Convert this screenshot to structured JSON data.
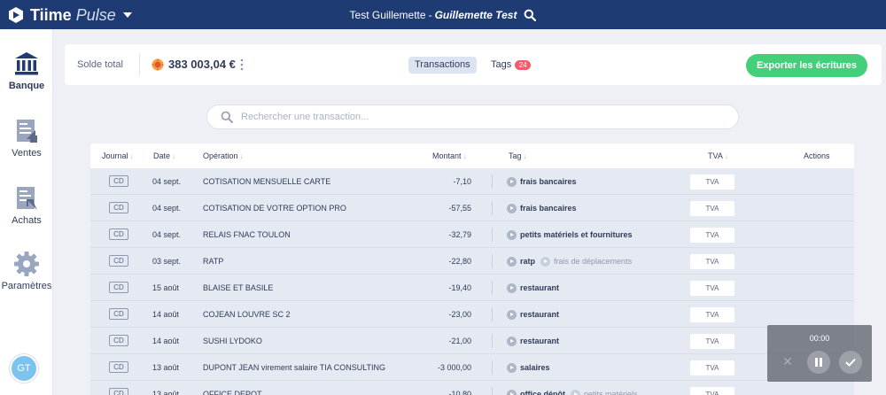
{
  "header": {
    "brand_name": "Tiime",
    "brand_sub": "Pulse",
    "company": "Test Guillemette",
    "separator": "-",
    "user": "Guillemette Test"
  },
  "sidebar": {
    "items": [
      {
        "label": "Banque",
        "icon": "bank-icon",
        "active": true
      },
      {
        "label": "Ventes",
        "icon": "sales-document-icon"
      },
      {
        "label": "Achats",
        "icon": "purchases-document-icon"
      },
      {
        "label": "Paramètres",
        "icon": "gear-icon"
      }
    ],
    "avatar_initials": "GT"
  },
  "summary": {
    "solde_label": "Solde total",
    "balance": "383 003,04 €",
    "tab_transactions": "Transactions",
    "tab_tags": "Tags",
    "tags_count": "24",
    "export_label": "Exporter les écritures"
  },
  "search": {
    "placeholder": "Rechercher une transaction..."
  },
  "table": {
    "columns": [
      "Journal",
      "Date",
      "Opération",
      "Montant",
      "Tag",
      "TVA",
      "Actions"
    ],
    "rows": [
      {
        "journal": "CD",
        "date": "04 sept.",
        "operation": "COTISATION MENSUELLE CARTE",
        "amount": "-7,10",
        "tag": "frais bancaires",
        "tag2": "",
        "tva": "TVA"
      },
      {
        "journal": "CD",
        "date": "04 sept.",
        "operation": "COTISATION DE VOTRE OPTION PRO",
        "amount": "-57,55",
        "tag": "frais bancaires",
        "tag2": "",
        "tva": "TVA"
      },
      {
        "journal": "CD",
        "date": "04 sept.",
        "operation": "RELAIS FNAC TOULON",
        "amount": "-32,79",
        "tag": "petits matériels et fournitures",
        "tag2": "",
        "tva": "TVA"
      },
      {
        "journal": "CD",
        "date": "03 sept.",
        "operation": "RATP",
        "amount": "-22,80",
        "tag": "ratp",
        "tag2": "frais de déplacements",
        "tva": "TVA"
      },
      {
        "journal": "CD",
        "date": "15 août",
        "operation": "BLAISE ET BASILE",
        "amount": "-19,40",
        "tag": "restaurant",
        "tag2": "",
        "tva": "TVA"
      },
      {
        "journal": "CD",
        "date": "14 août",
        "operation": "COJEAN LOUVRE SC 2",
        "amount": "-23,00",
        "tag": "restaurant",
        "tag2": "",
        "tva": "TVA"
      },
      {
        "journal": "CD",
        "date": "14 août",
        "operation": "SUSHI LYDOKO",
        "amount": "-21,00",
        "tag": "restaurant",
        "tag2": "",
        "tva": "TVA"
      },
      {
        "journal": "CD",
        "date": "13 août",
        "operation": "DUPONT JEAN virement salaire TIA CONSULTING",
        "amount": "-3 000,00",
        "tag": "salaires",
        "tag2": "",
        "tva": "TVA"
      },
      {
        "journal": "CD",
        "date": "13 août",
        "operation": "OFFICE DEPOT",
        "amount": "-10,80",
        "tag": "office dépôt",
        "tag2": "petits matériels",
        "tva": "TVA"
      }
    ]
  },
  "recorder": {
    "time": "00:00"
  },
  "colors": {
    "topbar": "#1e3b74",
    "accent_green": "#44d07a",
    "badge_red": "#f05d6c"
  }
}
